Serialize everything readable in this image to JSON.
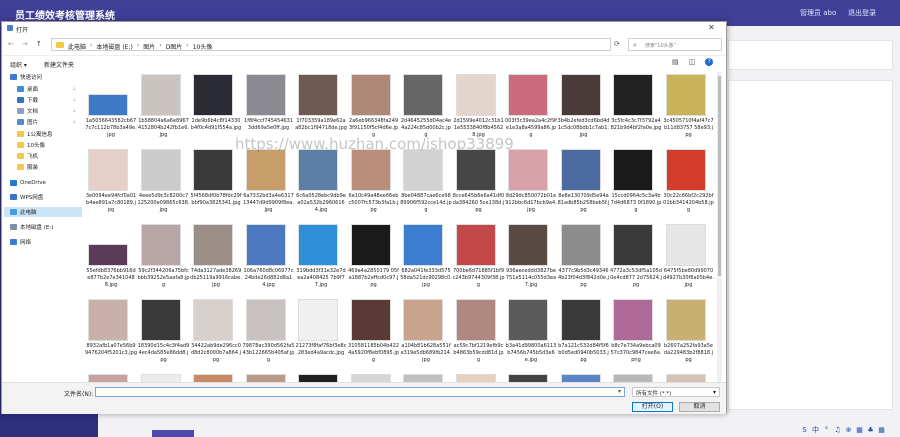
{
  "app": {
    "title": "员工绩效考核管理系统",
    "user": "管理员 abo",
    "logout": "退出登录"
  },
  "dialog": {
    "title": "打开",
    "close_glyph": "✕",
    "nav": {
      "back": "←",
      "forward": "→",
      "up": "↑"
    },
    "breadcrumbs": [
      "此电脑",
      "本地磁盘 (E:)",
      "图片",
      "D图片",
      "10头像"
    ],
    "breadcrumb_sep": "›",
    "refresh": "⟳",
    "search_placeholder": "搜索\"10头像\"",
    "search_icon": "⌕",
    "toolbar": {
      "organize": "组织 ▾",
      "new_folder": "新建文件夹",
      "view_glyph": "▤",
      "layout_glyph": "◫",
      "help": "?"
    }
  },
  "sidebar": {
    "items": [
      {
        "label": "快速访问",
        "icon": "star-icon",
        "color": "#3c7ad8",
        "level": 0,
        "pinned": false
      },
      {
        "label": "桌面",
        "icon": "desktop-icon",
        "color": "#3b8fd9",
        "level": 1,
        "pinned": true
      },
      {
        "label": "下载",
        "icon": "download-icon",
        "color": "#2f74c9",
        "level": 1,
        "pinned": true
      },
      {
        "label": "文档",
        "icon": "document-icon",
        "color": "#8aa1c2",
        "level": 1,
        "pinned": true
      },
      {
        "label": "图片",
        "icon": "pictures-icon",
        "color": "#4d8fd1",
        "level": 1,
        "pinned": true
      },
      {
        "label": "1公寓信息",
        "icon": "folder-icon",
        "color": "#f2c94c",
        "level": 1,
        "pinned": false
      },
      {
        "label": "10头像",
        "icon": "folder-icon",
        "color": "#f2c94c",
        "level": 1,
        "pinned": false
      },
      {
        "label": "飞机",
        "icon": "folder-icon",
        "color": "#f2c94c",
        "level": 1,
        "pinned": false
      },
      {
        "label": "服装",
        "icon": "folder-icon",
        "color": "#f2c94c",
        "level": 1,
        "pinned": false
      },
      {
        "label": "OneDrive",
        "icon": "cloud-icon",
        "color": "#1f7ad6",
        "level": 0,
        "pinned": false
      },
      {
        "label": "WPS网盘",
        "icon": "cloud-drive-icon",
        "color": "#3a74c8",
        "level": 0,
        "pinned": false
      },
      {
        "label": "此电脑",
        "icon": "computer-icon",
        "color": "#4b9be0",
        "level": 0,
        "pinned": false,
        "selected": true
      },
      {
        "label": "本地磁盘 (E:)",
        "icon": "disk-icon",
        "color": "#7f8ea3",
        "level": 0,
        "pinned": false
      },
      {
        "label": "网络",
        "icon": "network-icon",
        "color": "#3c7ad8",
        "level": 0,
        "pinned": false
      }
    ],
    "pin_glyph": "📌"
  },
  "files": [
    {
      "name": "1a5036643582cb677c7c112b78b3a49e.jpg",
      "color": "#3d79c4",
      "tall": false
    },
    {
      "name": "1b58804a6a6e89674152804b242fb1e6.jpg",
      "color": "#c9c4c0",
      "tall": true
    },
    {
      "name": "1de9b6b4c8f14330b4f0c4d91f554a.jpg",
      "color": "#2b2b35",
      "tall": true
    },
    {
      "name": "1f8f4ccf7454546313dd69a5e0ff.jpg",
      "color": "#8a8a90",
      "tall": true
    },
    {
      "name": "1f703359a189e62aa82bc1f94718de.jpg",
      "color": "#6e5a50",
      "tall": true
    },
    {
      "name": "2a6eb966348fa2493f91150f5cf4d6e.jpg",
      "color": "#b08878",
      "tall": true
    },
    {
      "name": "2d4645255d04ac4e4a224c85d00b2c.jpg",
      "color": "#666666",
      "tall": true
    },
    {
      "name": "2d1599e4012c31b11e5533840f8b45628.jpg",
      "color": "#e3d4cc",
      "tall": true
    },
    {
      "name": "003f3c39ea2a4c2f9fe1e3a8a4599a86.jpg",
      "color": "#c96b7a",
      "tall": true
    },
    {
      "name": "3b4b2efed3cd6bd4d1c5dc08bdb1c7ab1.jpg",
      "color": "#4a3a3a",
      "tall": true
    },
    {
      "name": "3c5fc4c3c7f3792a4821b9d4bf2fa0e.jpg",
      "color": "#222222",
      "tall": true
    },
    {
      "name": "3c4505710f4af47c7b11d83757 58e93.jpg",
      "color": "#c9b35a",
      "tall": true
    },
    {
      "name": "3e0094ee94fcf0a01b4ae891a7c80189.jpg",
      "color": "#e6cfc6",
      "tall": true
    },
    {
      "name": "4eee5d9c3c8200c7125200e09865c638.jpg",
      "color": "#cccccc",
      "tall": true
    },
    {
      "name": "5f4568df0b78fdc29fbbf90a3825341.jpg",
      "color": "#3a3a3a",
      "tall": true
    },
    {
      "name": "6a7332bd3a4e631713447d9d9909f8ea.jpg",
      "color": "#c79d6a",
      "tall": true
    },
    {
      "name": "6c6a0528ebc9db9ea02a532b29606164.jpg",
      "color": "#5b7fa6",
      "tall": true
    },
    {
      "name": "6e10c49a48ee66ebc5007fc573b3fa1b.jpg",
      "color": "#b88e7a",
      "tall": true
    },
    {
      "name": "8be04887cae6ce9889906f592cce14d.jpg",
      "color": "#d2d2d2",
      "tall": true
    },
    {
      "name": "8cce645b6e6a41df0da384260 5ce138d.jpg",
      "color": "#474747",
      "tall": true
    },
    {
      "name": "8d29dc850072b01e912bbc6d17bcb9a4.jpg",
      "color": "#d8a0a8",
      "tall": true
    },
    {
      "name": "8e8e130709d5e94a81adb85b258beb5f.jpg",
      "color": "#4a6aa0",
      "tall": true
    },
    {
      "name": "15ccd0964c5c3a4b7d4d6873 0f1890.jpg",
      "color": "#1a1a1a",
      "tall": true
    },
    {
      "name": "30c22c66bf2c292bf01bb3414204b58.jpg",
      "color": "#d43c2c",
      "tall": true
    },
    {
      "name": "55efdb8376bb916de877b2e7e3410488.jpg",
      "color": "#5c3a5a",
      "tall": false
    },
    {
      "name": "59c2f344206a75bfcbbb39252e5aafa8.jpg",
      "color": "#b8a6a6",
      "tall": true
    },
    {
      "name": "74da3127ade38269db25119a9916cabe.jpg",
      "color": "#9a8e86",
      "tall": true
    },
    {
      "name": "106a760d8c06977c24bde26d882d8a14.jpg",
      "color": "#4c78c0",
      "tall": true
    },
    {
      "name": "319bdd3f31e32e7dea2a408425 7b9f77.jpg",
      "color": "#2f8ed8",
      "tall": true
    },
    {
      "name": "469a4a2850179 05fa1887b2effcd0c97.jpg",
      "color": "#1a1a1a",
      "tall": true
    },
    {
      "name": "682a041fe333d57558da521dc90298c0.jpg",
      "color": "#3b7dcf",
      "tall": true
    },
    {
      "name": "700be6d71885f1bf9c243b9744309f38.jpg",
      "color": "#c2484a",
      "tall": true
    },
    {
      "name": "936aeceddd3827be751e5114c055d3ea7.jpg",
      "color": "#5a4a44",
      "tall": true
    },
    {
      "name": "4377c9b5d3c493464b23f04d3f842d0e.jpg",
      "color": "#8c8c8c",
      "tall": true
    },
    {
      "name": "4772a3c53df5a105d0e4cd877 2d75624.jpg",
      "color": "#3a3a3a",
      "tall": true
    },
    {
      "name": "6475f5be80d99070d4927b30f8a05b4e.jpg",
      "color": "#e6e6e6",
      "tall": true
    },
    {
      "name": "8932afb1a07e56b99476204f5201c3.jpg",
      "color": "#c9b0a8",
      "tall": true
    },
    {
      "name": "18390d15c4c3f4ad94ec4da585e86dd8.jpg",
      "color": "#3a3a3a",
      "tall": true
    },
    {
      "name": "34422ab9de296cc0d8d2c8000b7a864.jpg",
      "color": "#d8d0cc",
      "tall": true
    },
    {
      "name": "79878ac390d562fa543b122665b405af.jpg",
      "color": "#c8c3c1",
      "tall": true
    },
    {
      "name": "21273f8faf76bf3e8c283ed4a9acdc.jpg",
      "color": "#f0f0f0",
      "tall": true
    },
    {
      "name": "310581185b04b4224a5920f8ebf0895.jpg",
      "color": "#5a3a34",
      "tall": true
    },
    {
      "name": "a104b81b628a551fe319e5db689fb214.jpg",
      "color": "#c9a38e",
      "tall": true
    },
    {
      "name": "ac59c7bf1219efb9cb4863b59cdd81d.jpg",
      "color": "#b08880",
      "tall": true
    },
    {
      "name": "b3a41d99800a6113b7456b745b5d3e6e.jpg",
      "color": "#5a5a5a",
      "tall": true
    },
    {
      "name": "b7a121c532d84f5f6b0d5ed0940b5033.jpg",
      "color": "#3a3a3a",
      "tall": true
    },
    {
      "name": "b8c7e734a9ebca0957c370c9847cee6a.png",
      "color": "#b06a9a",
      "tall": true
    },
    {
      "name": "b2607a252fa93a5eda229483b2f8818.jpg",
      "color": "#c8b070",
      "tall": true
    },
    {
      "name": "",
      "color": "#c8a4a0",
      "tall": true
    },
    {
      "name": "",
      "color": "#ececec",
      "tall": true
    },
    {
      "name": "",
      "color": "#c88a64",
      "tall": true
    },
    {
      "name": "",
      "color": "#b89a86",
      "tall": true
    },
    {
      "name": "",
      "color": "#202020",
      "tall": true
    },
    {
      "name": "",
      "color": "#d6d6d6",
      "tall": true
    },
    {
      "name": "",
      "color": "#c0c0c0",
      "tall": true
    },
    {
      "name": "",
      "color": "#e8d0c0",
      "tall": true
    },
    {
      "name": "",
      "color": "#444444",
      "tall": true
    },
    {
      "name": "",
      "color": "#5a86c6",
      "tall": true
    },
    {
      "name": "",
      "color": "#b8b8b8",
      "tall": true
    },
    {
      "name": "",
      "color": "#d2c3b3",
      "tall": true
    }
  ],
  "bottom": {
    "filename_label": "文件名(N):",
    "filename_value": "",
    "filetype": "所有文件 (*.*)",
    "dropdown_glyph": "▾",
    "open_label": "打开(O)",
    "cancel_label": "取消"
  },
  "watermark": "https://www.huzhan.com/ishop33899",
  "tray": [
    "S",
    "中",
    "°",
    "♫",
    "⊕",
    "▦",
    "♣",
    "▦"
  ]
}
